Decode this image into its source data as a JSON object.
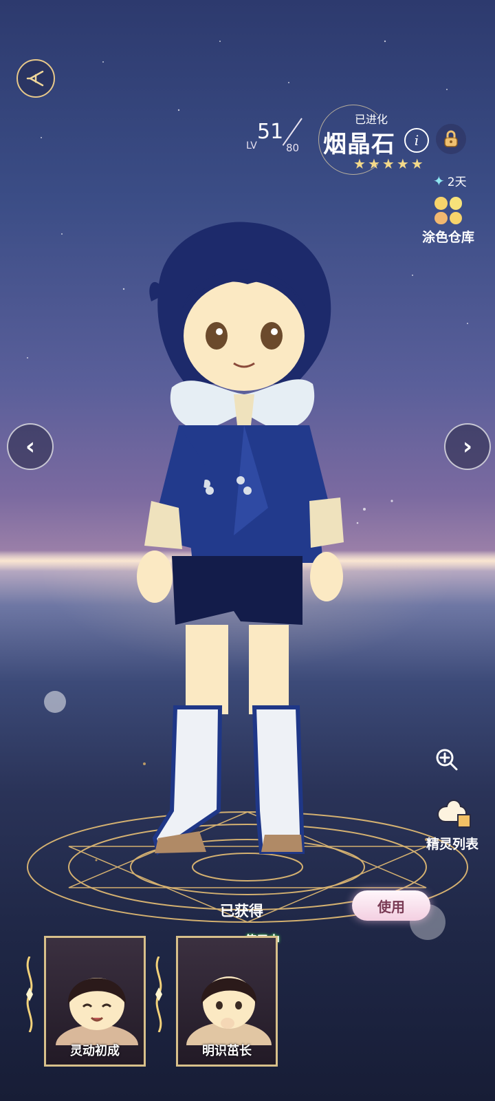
{
  "header": {
    "level_label": "LV",
    "level_value": "51",
    "level_max": "80",
    "evolved_tag": "已进化",
    "name": "烟晶石",
    "info_glyph": "i",
    "star_rating": 5
  },
  "duration": {
    "value": "2天"
  },
  "palette": {
    "label": "涂色仓库"
  },
  "roster": {
    "label": "精灵列表"
  },
  "bottom": {
    "owned_label": "已获得",
    "use_button": "使用",
    "in_use_tag": "使用中"
  },
  "outfits": [
    {
      "name": "灵动初成"
    },
    {
      "name": "明识茁长"
    }
  ],
  "colors": {
    "gold": "#e8c98a",
    "star": "#f4d98a",
    "pink_button": "#f3cfe1",
    "in_use_glow": "#4fd65a"
  }
}
